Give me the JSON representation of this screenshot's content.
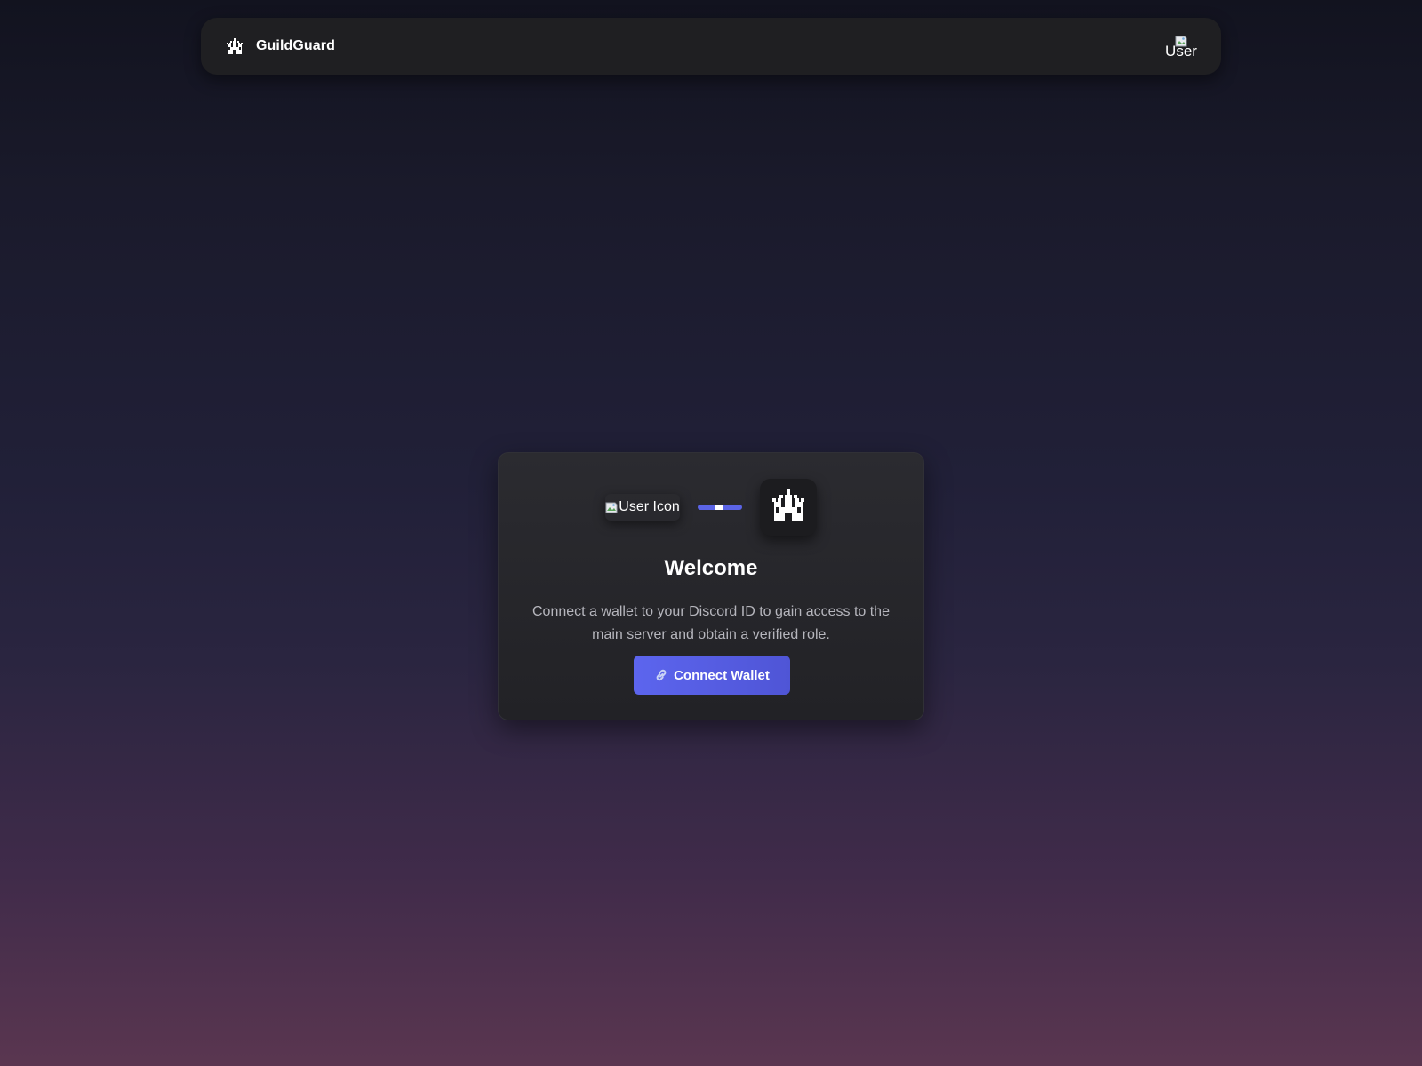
{
  "header": {
    "brand_icon": "castle-icon",
    "brand_name": "GuildGuard",
    "avatar_alt": "User"
  },
  "card": {
    "user_icon_alt": "User Icon",
    "server_icon": "castle-icon",
    "title": "Welcome",
    "description": "Connect a wallet to your Discord ID to gain access to the main server and obtain a verified role.",
    "button_icon": "link-icon",
    "button_label": "Connect Wallet"
  },
  "colors": {
    "accent": "#5b64e6",
    "card_bg": "#2b2b30",
    "topbar_bg": "#1f1f22",
    "text_muted": "#b6b6bd"
  }
}
